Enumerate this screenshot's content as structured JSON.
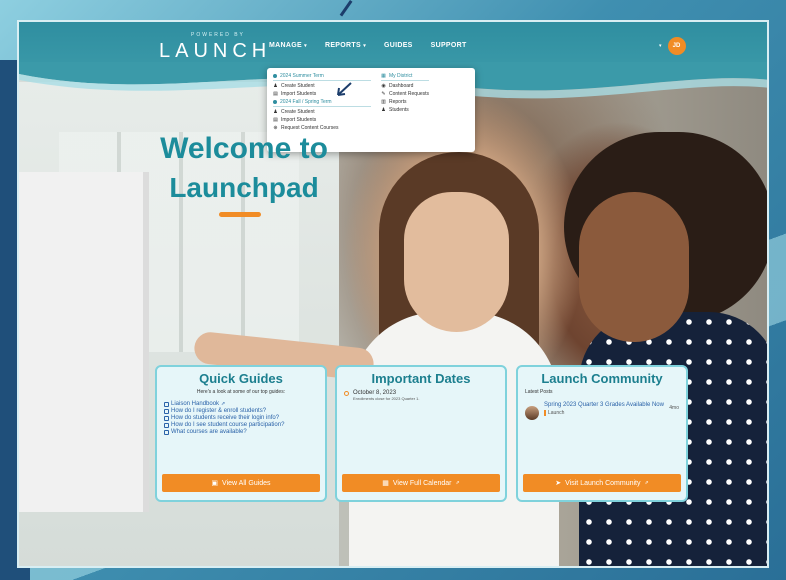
{
  "header": {
    "logo_small": "POWERED BY",
    "logo": "LAUNCH",
    "nav": [
      {
        "label": "MANAGE",
        "caret": "▾"
      },
      {
        "label": "REPORTS",
        "caret": "▾"
      },
      {
        "label": "GUIDES",
        "caret": ""
      },
      {
        "label": "SUPPORT",
        "caret": ""
      }
    ],
    "user_caret": "▾",
    "user_initials": "JD"
  },
  "dropdown": {
    "left": {
      "section1": "2024 Summer Term",
      "section1_items": [
        "Create Student",
        "Import Students"
      ],
      "section2": "2024 Fall / Spring Term",
      "section2_items": [
        "Create Student",
        "Import Students",
        "Request Content Courses"
      ]
    },
    "right": {
      "section": "My District",
      "items": [
        "Dashboard",
        "Content Requests",
        "Reports",
        "Students"
      ]
    }
  },
  "welcome": {
    "line1": "Welcome to",
    "line2": "Launchpad"
  },
  "quick_guides": {
    "title": "Quick Guides",
    "subtitle": "Here's a look at some of our top guides:",
    "links": [
      "Liaison Handbook",
      "How do I register & enroll students?",
      "How do students receive their login info?",
      "How do I see student course participation?",
      "What courses are available?"
    ],
    "button": "View All Guides"
  },
  "important_dates": {
    "title": "Important Dates",
    "date": "October 8, 2023",
    "note": "Enrollments close for 2023 Quarter 1.",
    "button": "View Full Calendar"
  },
  "community": {
    "title": "Launch Community",
    "posts_label": "Latest Posts",
    "post_title": "Spring 2023 Quarter 3 Grades Available Now",
    "post_tag": "Launch",
    "post_time": "4mo",
    "button": "Visit Launch Community"
  },
  "colors": {
    "header_teal": "#2f8ea0",
    "accent_orange": "#f18c25",
    "title_teal": "#1c8c9b",
    "link_blue": "#2a62a8"
  },
  "icons": {
    "ext": "⇗",
    "guide_btn": "▣",
    "calendar_btn": "▦",
    "rocket_btn": "➤"
  }
}
